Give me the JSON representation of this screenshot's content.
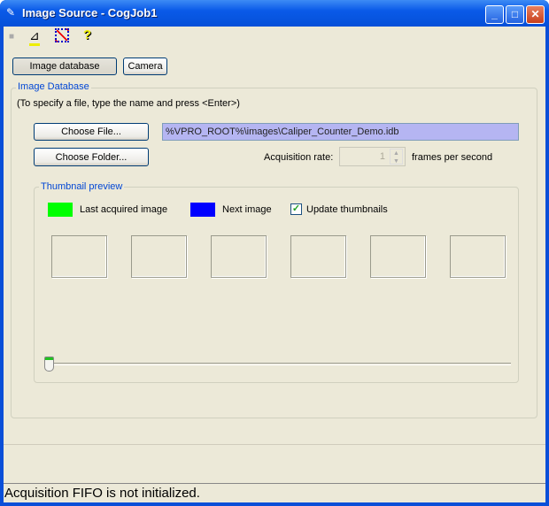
{
  "window": {
    "title": "Image Source - CogJob1",
    "controls": [
      "minimize",
      "maximize",
      "close"
    ]
  },
  "toolbar": {
    "icons": [
      "camera-icon",
      "graphics-icon",
      "no-region-icon",
      "help-icon"
    ]
  },
  "tabs": {
    "image_database": "Image database",
    "camera": "Camera"
  },
  "image_database": {
    "group_label": "Image Database",
    "hint": "(To specify a file, type the name and press <Enter>)",
    "choose_file": "Choose File...",
    "file_path": "%VPRO_ROOT%\\images\\Caliper_Counter_Demo.idb",
    "choose_folder": "Choose Folder...",
    "acq_rate_label": "Acquisition rate:",
    "acq_rate_value": "1",
    "acq_rate_unit": "frames per second"
  },
  "thumbnail": {
    "group_label": "Thumbnail preview",
    "last_label": "Last acquired image",
    "last_color": "#00FF00",
    "next_label": "Next image",
    "next_color": "#0000FF",
    "update_label": "Update thumbnails",
    "update_checked": true,
    "count": 6,
    "slider_position": 0
  },
  "status": "Acquisition FIFO is not initialized."
}
